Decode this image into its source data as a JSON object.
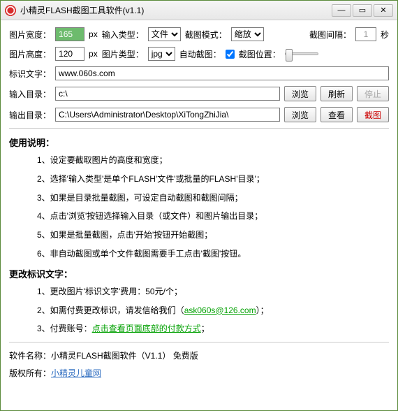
{
  "title": "小精灵FLASH截图工具软件(v1.1)",
  "row1": {
    "pic_w_label": "图片宽度：",
    "pic_w": "165",
    "px": "px",
    "in_type_label": "输入类型：",
    "in_type": "文件",
    "cap_mode_label": "截图模式：",
    "cap_mode": "缩放",
    "interval_label": "截图间隔：",
    "interval": "1",
    "sec": "秒"
  },
  "row2": {
    "pic_h_label": "图片高度：",
    "pic_h": "120",
    "img_type_label": "图片类型：",
    "img_type": "jpg",
    "auto_label": "自动截图：",
    "pos_label": "截图位置："
  },
  "row3": {
    "label": "标识文字：",
    "value": "www.060s.com"
  },
  "row4": {
    "label": "输入目录：",
    "value": "c:\\",
    "browse": "浏览",
    "refresh": "刷新",
    "stop": "停止"
  },
  "row5": {
    "label": "输出目录：",
    "value": "C:\\Users\\Administrator\\Desktop\\XiTongZhiJia\\",
    "browse": "浏览",
    "view": "查看",
    "capture": "截图"
  },
  "usage": {
    "title": "使用说明：",
    "items": [
      "1、设定要截取图片的高度和宽度；",
      "2、选择'输入类型'是单个FLASH'文件'或批量的FLASH'目录'；",
      "3、如果是目录批量截图，可设定自动截图和截图间隔；",
      "4、点击'浏览'按钮选择输入目录（或文件）和图片输出目录；",
      "5、如果是批量截图，点击'开始'按钮开始截图；",
      "6、非自动截图或单个文件截图需要手工点击'截图'按钮。"
    ]
  },
  "change": {
    "title": "更改标识文字：",
    "i1": "1、更改图片'标识文字'费用：50元/个；",
    "i2a": "2、如需付费更改标识，请发信给我们（",
    "i2link": "ask060s@126.com",
    "i2b": "）；",
    "i3a": "3、付费账号：",
    "i3link": "点击查看页面底部的付款方式",
    "i3b": "；"
  },
  "footer": {
    "l1": "软件名称：小精灵FLASH截图软件（V1.1）  免费版",
    "l2a": "版权所有：",
    "l2link": "小精灵儿童网"
  }
}
